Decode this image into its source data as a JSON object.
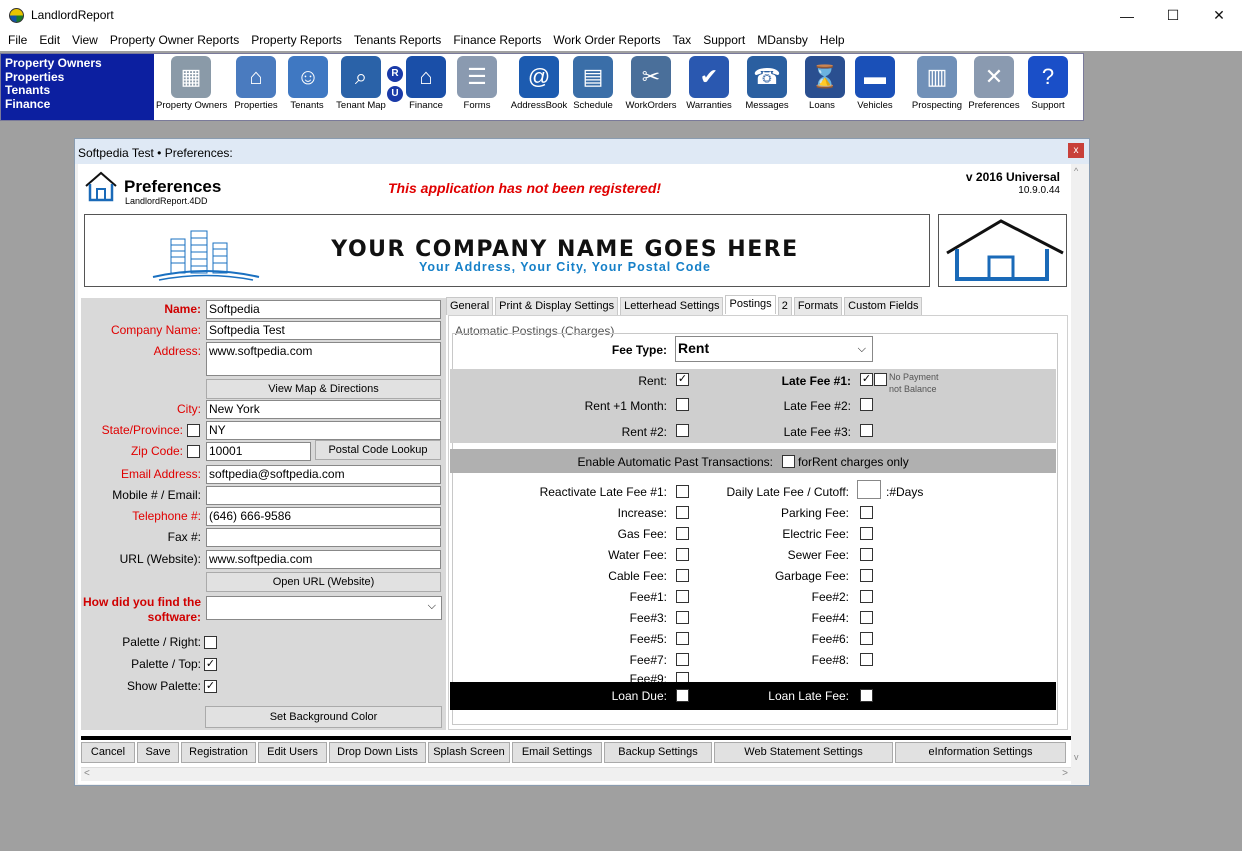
{
  "window": {
    "title": "LandlordReport",
    "minimize_glyph": "—",
    "maximize_glyph": "☐",
    "close_glyph": "✕"
  },
  "menu": [
    "File",
    "Edit",
    "View",
    "Property Owner Reports",
    "Property Reports",
    "Tenants Reports",
    "Finance Reports",
    "Work Order Reports",
    "Tax",
    "Support",
    "MDansby",
    "Help"
  ],
  "nav": [
    "Property Owners",
    "Properties",
    "Tenants",
    "Finance"
  ],
  "toolbar": [
    {
      "label": "Property Owners",
      "icon": "buildings-icon",
      "color": "#8a9aa8"
    },
    {
      "label": "Properties",
      "icon": "houses-icon",
      "color": "#4a7bbf"
    },
    {
      "label": "Tenants",
      "icon": "people-icon",
      "color": "#3f78c2"
    },
    {
      "label": "Tenant Map",
      "icon": "magnifier-map-icon",
      "color": "#2a62a8"
    },
    {
      "label": "Finance",
      "icon": "bank-icon",
      "color": "#1a4fa8"
    },
    {
      "label": "Forms",
      "icon": "forms-icon",
      "color": "#8a9ab0"
    },
    {
      "label": "AddressBook",
      "icon": "address-book-icon",
      "color": "#1c5bb0"
    },
    {
      "label": "Schedule",
      "icon": "calendar-icon",
      "color": "#3a6ea8"
    },
    {
      "label": "WorkOrders",
      "icon": "tools-icon",
      "color": "#4a6f9a"
    },
    {
      "label": "Warranties",
      "icon": "warranty-badge-icon",
      "color": "#2a58b0"
    },
    {
      "label": "Messages",
      "icon": "telephone-icon",
      "color": "#2a5fa0"
    },
    {
      "label": "Loans",
      "icon": "hourglass-icon",
      "color": "#2a4f90"
    },
    {
      "label": "Vehicles",
      "icon": "car-icon",
      "color": "#1a50b8"
    },
    {
      "label": "Prospecting",
      "icon": "tower-icon",
      "color": "#7090b8"
    },
    {
      "label": "Preferences",
      "icon": "wrench-screwdriver-icon",
      "color": "#8a9ab0"
    },
    {
      "label": "Support",
      "icon": "question-icon",
      "color": "#1a4fc8"
    }
  ],
  "pref_window": {
    "title": "Softpedia Test  •  Preferences:",
    "close_glyph": "x",
    "heading": "Preferences",
    "sub": "LandlordReport.4DD",
    "unregistered": "This application has not been registered!",
    "version": "v 2016 Universal",
    "build": "10.9.0.44"
  },
  "letterhead": {
    "company": "YOUR COMPANY NAME GOES HERE",
    "address": "Your Address, Your City, Your Postal Code"
  },
  "form": {
    "name_label": "Name:",
    "name": "Softpedia",
    "company_label": "Company Name:",
    "company": "Softpedia Test",
    "address_label": "Address:",
    "address": "www.softpedia.com",
    "map_button": "View Map & Directions",
    "city_label": "City:",
    "city": "New York",
    "state_label": "State/Province:",
    "state": "NY",
    "zip_label": "Zip Code:",
    "zip": "10001",
    "postal_button": "Postal Code Lookup",
    "email_label": "Email Address:",
    "email": "softpedia@softpedia.com",
    "mobile_label": "Mobile # / Email:",
    "mobile": "",
    "phone_label": "Telephone #:",
    "phone": "(646) 666-9586",
    "fax_label": "Fax #:",
    "fax": "",
    "url_label": "URL (Website):",
    "url": "www.softpedia.com",
    "open_url_button": "Open URL (Website)",
    "how_label_1": "How did you find the",
    "how_label_2": "software:",
    "how_value": "",
    "palette_right_label": "Palette / Right:",
    "palette_top_label": "Palette / Top:",
    "show_palette_label": "Show Palette:",
    "bg_button": "Set Background Color",
    "check_glyph": "✓",
    "dropdown_glyph": "⌵"
  },
  "tabs": [
    "General",
    "Print & Display Settings",
    "Letterhead Settings",
    "Postings",
    "2",
    "Formats",
    "Custom Fields"
  ],
  "postings": {
    "group": "Automatic Postings (Charges)",
    "fee_type_label": "Fee Type:",
    "fee_type": "Rent",
    "rent": "Rent:",
    "rent_plus": "Rent +1 Month:",
    "rent2": "Rent #2:",
    "late1": "Late Fee #1:",
    "late2": "Late Fee #2:",
    "late3": "Late Fee #3:",
    "no_payment": "No Payment",
    "not_balance": "not Balance",
    "enable_past": "Enable Automatic Past Transactions:",
    "rent_only": "forRent charges only",
    "reactivate": "Reactivate Late Fee #1:",
    "daily_late": "Daily Late Fee / Cutoff:",
    "days": ":#Days",
    "left_fees": [
      "Increase:",
      "Gas Fee:",
      "Water Fee:",
      "Cable Fee:",
      "Fee#1:",
      "Fee#3:",
      "Fee#5:",
      "Fee#7:",
      "Fee#9:"
    ],
    "right_fees": [
      "Parking Fee:",
      "Electric Fee:",
      "Sewer Fee:",
      "Garbage Fee:",
      "Fee#2:",
      "Fee#4:",
      "Fee#6:",
      "Fee#8:"
    ],
    "loan_due": "Loan Due:",
    "loan_late": "Loan Late Fee:"
  },
  "bottom_buttons": [
    "Cancel",
    "Save",
    "Registration",
    "Edit Users",
    "Drop Down Lists",
    "Splash Screen",
    "Email Settings",
    "Backup Settings",
    "Web Statement Settings",
    "eInformation Settings"
  ],
  "colors": {
    "nav_bg": "#0c1fa0",
    "required_label": "#e00000",
    "unregistered": "#e00000",
    "address_blue": "#1680c8"
  }
}
